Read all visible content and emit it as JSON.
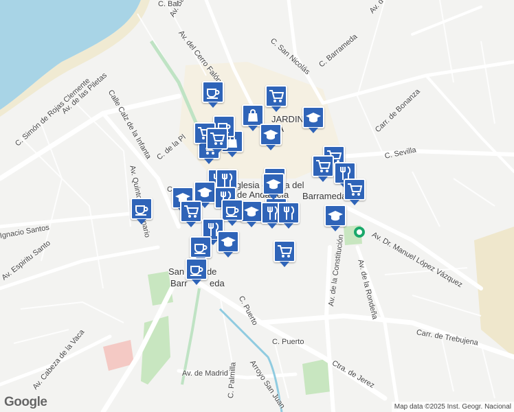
{
  "map": {
    "street_labels": [
      {
        "text": "Av. Bajo",
        "rot": -60
      },
      {
        "text": "Av. del Cerro Falón",
        "rot": 52
      },
      {
        "text": "C. San Nicolás",
        "rot": 42
      },
      {
        "text": "C. Barrameda",
        "rot": -40
      },
      {
        "text": "Av. de las Piletas",
        "rot": -42
      },
      {
        "text": "C. Simón de Rojas Clemente",
        "rot": -42
      },
      {
        "text": "Calle Calz de la Infanta",
        "rot": 60
      },
      {
        "text": "Av. Quinto Centenario",
        "rot": 78
      },
      {
        "text": "C. de la Pl",
        "rot": -40
      },
      {
        "text": "Carr. de Bonanza",
        "rot": -44
      },
      {
        "text": "C. Sevilla",
        "rot": -12
      },
      {
        "text": "Av. Dr. Manuel López Vázquez",
        "rot": 30
      },
      {
        "text": "Av. de la Constitución",
        "rot": -82
      },
      {
        "text": "Av. de la Rondeña",
        "rot": 76
      },
      {
        "text": "Carr. de Trebujena",
        "rot": 10
      },
      {
        "text": "C. Puerto",
        "rot": 62
      },
      {
        "text": "C. Puerto",
        "rot": 0
      },
      {
        "text": "Ctra. de Jerez",
        "rot": 30
      },
      {
        "text": "Av. de Madrid",
        "rot": 0
      },
      {
        "text": "C. Palmilla",
        "rot": -86
      },
      {
        "text": "Arroyo San Juan",
        "rot": 56
      },
      {
        "text": "Av. Cabeza de la Vaca",
        "rot": -50
      },
      {
        "text": "Av. Espiritu Santo",
        "rot": -38
      },
      {
        "text": "Ignacio Santos",
        "rot": -10
      },
      {
        "text": "C. Bal",
        "rot": 0
      },
      {
        "text": "Av. d",
        "rot": -48
      },
      {
        "text": "C",
        "rot": 0
      },
      {
        "text": "Iglesia de N",
        "rot": 0
      },
      {
        "text": "ra del",
        "rot": 0
      },
      {
        "text": "de Andalucía",
        "rot": 0
      },
      {
        "text": "Barrameda...",
        "rot": 0
      },
      {
        "text": "JARDIN",
        "rot": 0
      },
      {
        "text": "CA",
        "rot": 0
      },
      {
        "text": "San",
        "rot": 0
      },
      {
        "text": "r de",
        "rot": 0
      },
      {
        "text": "Barr",
        "rot": 0
      },
      {
        "text": "eda",
        "rot": 0
      }
    ],
    "markers": [
      {
        "type": "coffee"
      },
      {
        "type": "shopping"
      },
      {
        "type": "shopping-bag"
      },
      {
        "type": "shopping"
      },
      {
        "type": "education"
      },
      {
        "type": "education"
      },
      {
        "type": "shopping-bag"
      },
      {
        "type": "shopping"
      },
      {
        "type": "shopping"
      },
      {
        "type": "restaurant"
      },
      {
        "type": "education"
      },
      {
        "type": "restaurant"
      },
      {
        "type": "shopping"
      },
      {
        "type": "coffee"
      },
      {
        "type": "education"
      },
      {
        "type": "education"
      },
      {
        "type": "restaurant"
      },
      {
        "type": "restaurant"
      },
      {
        "type": "shopping"
      },
      {
        "type": "education"
      },
      {
        "type": "coffee"
      },
      {
        "type": "restaurant"
      },
      {
        "type": "education"
      },
      {
        "type": "restaurant"
      },
      {
        "type": "coffee"
      },
      {
        "type": "education"
      },
      {
        "type": "shopping"
      },
      {
        "type": "coffee"
      },
      {
        "type": "restaurant"
      },
      {
        "type": "education"
      },
      {
        "type": "coffee"
      },
      {
        "type": "shopping"
      },
      {
        "type": "shopping"
      },
      {
        "type": "education"
      }
    ],
    "current_location_icon": "location-dot-icon"
  },
  "footer": {
    "logo": "Google",
    "attribution": "Map data ©2025 Inst. Geogr. Nacional"
  },
  "colors": {
    "water": "#a8d4e6",
    "park": "#c8e6c0",
    "marker": "#2f64b8",
    "road": "#ffffff",
    "river": "#8fcbe0",
    "highway": "#bfe3c4"
  }
}
